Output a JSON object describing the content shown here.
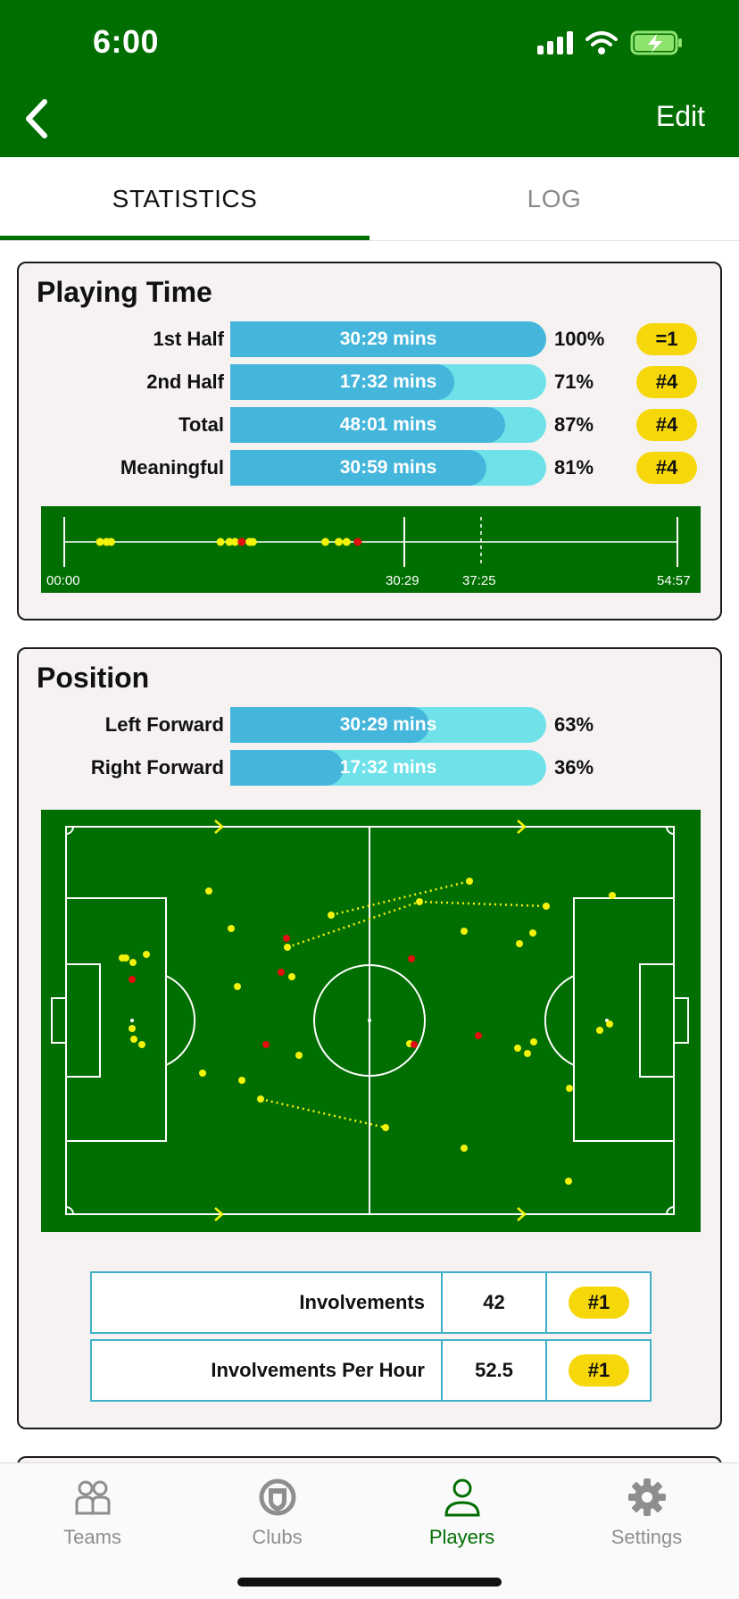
{
  "status_bar": {
    "time": "6:00"
  },
  "nav": {
    "edit_label": "Edit"
  },
  "tabs": [
    {
      "label": "STATISTICS",
      "active": true
    },
    {
      "label": "LOG",
      "active": false
    }
  ],
  "playing_time": {
    "title": "Playing Time",
    "rows": [
      {
        "label": "1st Half",
        "time": "30:29 mins",
        "percent": "100%",
        "rank": "=1",
        "fill": 1.0
      },
      {
        "label": "2nd Half",
        "time": "17:32 mins",
        "percent": "71%",
        "rank": "#4",
        "fill": 0.71
      },
      {
        "label": "Total",
        "time": "48:01 mins",
        "percent": "87%",
        "rank": "#4",
        "fill": 0.87
      },
      {
        "label": "Meaningful",
        "time": "30:59 mins",
        "percent": "81%",
        "rank": "#4",
        "fill": 0.81
      }
    ],
    "timeline": {
      "labels": {
        "start": "00:00",
        "half": "30:29",
        "sub": "37:25",
        "end": "54:57"
      },
      "markers_yellow": [
        3.2,
        3.8,
        4.2,
        14.0,
        14.8,
        15.3,
        16.6,
        16.9,
        23.4,
        24.6,
        25.3
      ],
      "markers_red": [
        15.9,
        26.3
      ]
    }
  },
  "position": {
    "title": "Position",
    "rows": [
      {
        "label": "Left Forward",
        "time": "30:29 mins",
        "percent": "63%",
        "fill": 0.63
      },
      {
        "label": "Right Forward",
        "time": "17:32 mins",
        "percent": "36%",
        "fill": 0.36
      }
    ],
    "stats": [
      {
        "label": "Involvements",
        "value": "42",
        "rank": "#1"
      },
      {
        "label": "Involvements Per Hour",
        "value": "52.5",
        "rank": "#1"
      }
    ]
  },
  "tabbar": [
    {
      "label": "Teams",
      "icon": "teams-icon",
      "active": false
    },
    {
      "label": "Clubs",
      "icon": "clubs-icon",
      "active": false
    },
    {
      "label": "Players",
      "icon": "players-icon",
      "active": true
    },
    {
      "label": "Settings",
      "icon": "settings-icon",
      "active": false
    }
  ],
  "colors": {
    "brand_green": "#006e00",
    "bar_fill": "#45b6db",
    "bar_track": "#6ee1e9",
    "badge": "#f6d70a",
    "marker_yellow": "#f2f20a",
    "marker_red": "#e01010"
  }
}
